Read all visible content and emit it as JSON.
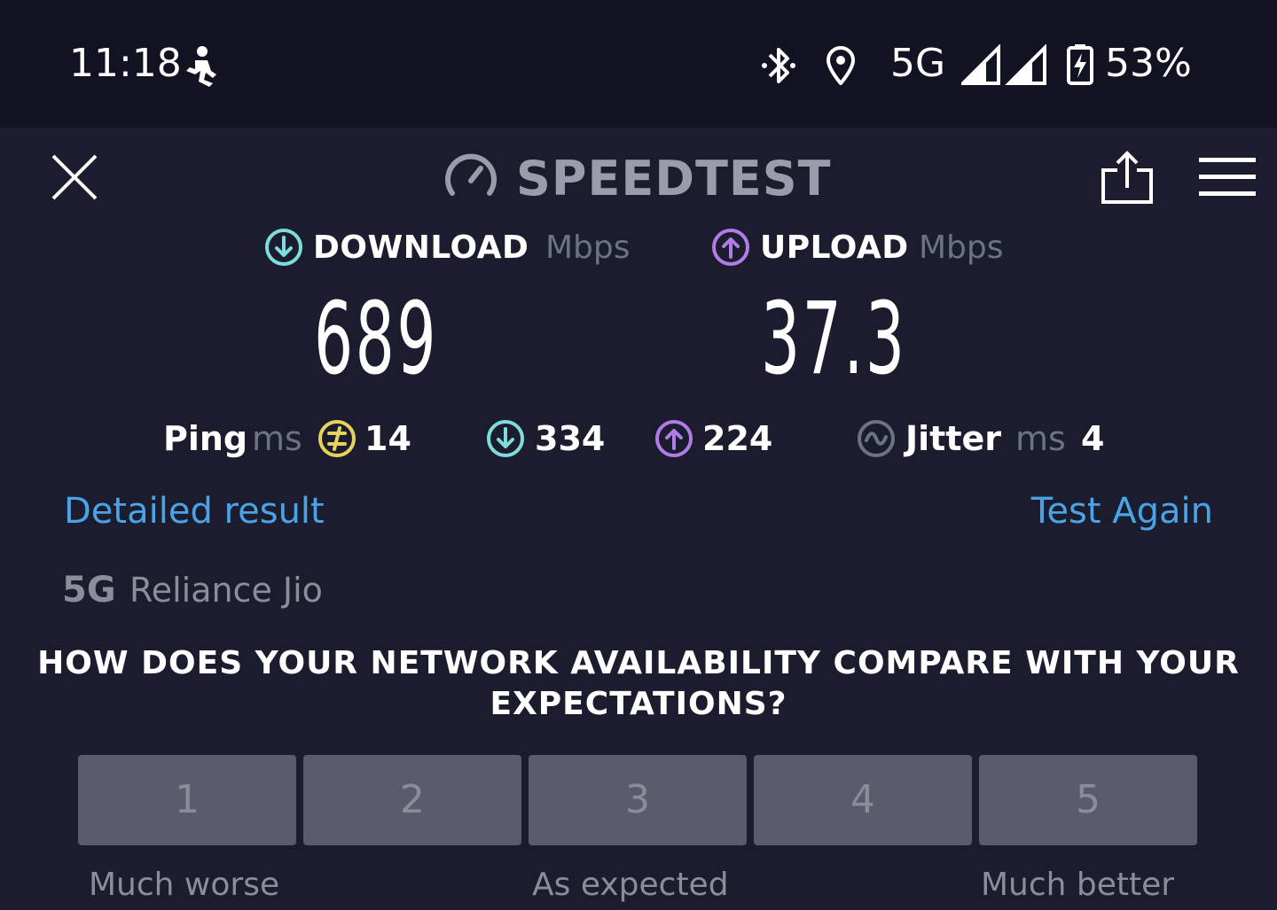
{
  "status_bar": {
    "time": "11:18",
    "network": "5G",
    "battery": "53%",
    "icons": [
      "running-person-icon",
      "bluetooth-icon",
      "location-icon",
      "signal-icon",
      "battery-charging-icon"
    ]
  },
  "header": {
    "title": "SPEEDTEST",
    "icons": [
      "close-icon",
      "speedometer-icon",
      "share-icon",
      "menu-icon"
    ]
  },
  "download": {
    "label": "DOWNLOAD",
    "unit": "Mbps",
    "value": "689",
    "color": "#7fdcdc"
  },
  "upload": {
    "label": "UPLOAD",
    "unit": "Mbps",
    "value": "37.3",
    "color": "#b07ce8"
  },
  "stats": {
    "ping_label": "Ping",
    "ping_unit": "ms",
    "ping_value": "14",
    "ping_color": "#e8d35a",
    "download_latency": "334",
    "upload_latency": "224",
    "jitter_label": "Jitter",
    "jitter_unit": "ms",
    "jitter_value": "4"
  },
  "links": {
    "detailed": "Detailed result",
    "again": "Test Again",
    "color": "#4aa3e6"
  },
  "carrier": {
    "tech": "5G",
    "name": "Reliance Jio"
  },
  "survey": {
    "question": "HOW DOES YOUR NETWORK AVAILABILITY COMPARE WITH YOUR EXPECTATIONS?",
    "options": [
      "1",
      "2",
      "3",
      "4",
      "5"
    ],
    "labels": {
      "low": "Much worse",
      "mid": "As expected",
      "high": "Much better"
    }
  }
}
